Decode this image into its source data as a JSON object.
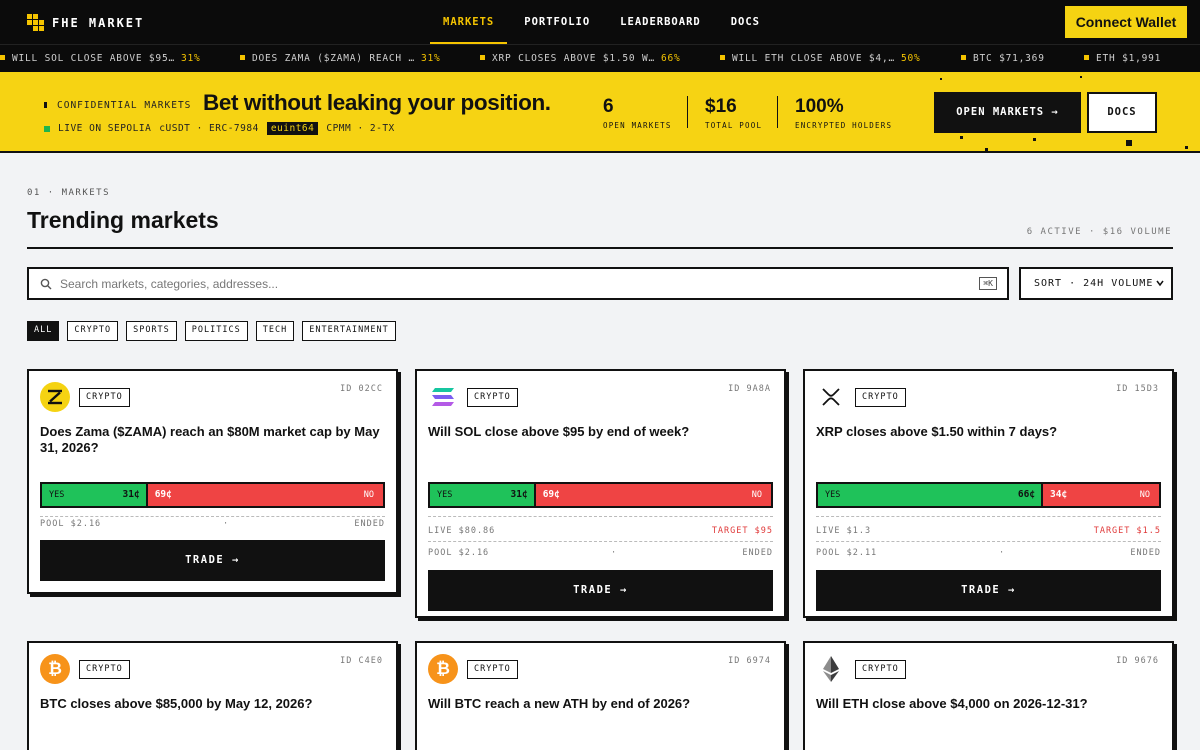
{
  "brand": {
    "name": "FHE MARKET"
  },
  "nav": {
    "items": [
      "MARKETS",
      "PORTFOLIO",
      "LEADERBOARD",
      "DOCS"
    ],
    "connect": "Connect Wallet"
  },
  "ticker": [
    {
      "text": "WILL SOL CLOSE ABOVE $95…",
      "pct": "31%"
    },
    {
      "text": "DOES ZAMA ($ZAMA) REACH …",
      "pct": "31%"
    },
    {
      "text": "XRP CLOSES ABOVE $1.50 W…",
      "pct": "66%"
    },
    {
      "text": "WILL ETH CLOSE ABOVE $4,…",
      "pct": "50%"
    },
    {
      "text": "BTC $71,369",
      "pct": ""
    },
    {
      "text": "ETH $1,991",
      "pct": ""
    }
  ],
  "hero": {
    "kicker": "CONFIDENTIAL MARKETS",
    "title": "Bet without leaking your position.",
    "live": "LIVE ON SEPOLIA",
    "token": "cUSDT · ERC-7984",
    "badge": "euint64",
    "amm": "CPMM · 2-TX",
    "stats": [
      {
        "value": "6",
        "label": "OPEN MARKETS"
      },
      {
        "value": "$16",
        "label": "TOTAL POOL"
      },
      {
        "value": "100%",
        "label": "ENCRYPTED HOLDERS"
      }
    ],
    "open_btn": "OPEN MARKETS →",
    "docs_btn": "DOCS"
  },
  "section": {
    "label": "01 · MARKETS",
    "title": "Trending markets",
    "meta": "6 ACTIVE · $16 VOLUME",
    "search_placeholder": "Search markets, categories, addresses...",
    "kbd": "⌘K",
    "sort": "SORT · 24H VOLUME"
  },
  "filters": [
    "ALL",
    "CRYPTO",
    "SPORTS",
    "POLITICS",
    "TECH",
    "ENTERTAINMENT"
  ],
  "cards": [
    {
      "tag": "CRYPTO",
      "id": "ID 02CC",
      "question": "Does Zama ($ZAMA) reach an $80M market cap by May 31, 2026?",
      "yes_label": "YES",
      "yes": "31¢",
      "yes_share": 0.31,
      "no": "69¢",
      "no_label": "NO",
      "live": "",
      "target": "",
      "pool": "POOL $2.16",
      "status": "ENDED",
      "trade": "TRADE →",
      "logo": "zama-logo"
    },
    {
      "tag": "CRYPTO",
      "id": "ID 9A8A",
      "question": "Will SOL close above $95 by end of week?",
      "yes_label": "YES",
      "yes": "31¢",
      "yes_share": 0.31,
      "no": "69¢",
      "no_label": "NO",
      "live": "LIVE $80.86",
      "target": "TARGET $95",
      "pool": "POOL $2.16",
      "status": "ENDED",
      "trade": "TRADE →",
      "logo": "solana-logo"
    },
    {
      "tag": "CRYPTO",
      "id": "ID 15D3",
      "question": "XRP closes above $1.50 within 7 days?",
      "yes_label": "YES",
      "yes": "66¢",
      "yes_share": 0.66,
      "no": "34¢",
      "no_label": "NO",
      "live": "LIVE $1.3",
      "target": "TARGET $1.5",
      "pool": "POOL $2.11",
      "status": "ENDED",
      "trade": "TRADE →",
      "logo": "xrp-logo"
    },
    {
      "tag": "CRYPTO",
      "id": "ID C4E0",
      "question": "BTC closes above $85,000 by May 12, 2026?",
      "logo": "bitcoin-logo"
    },
    {
      "tag": "CRYPTO",
      "id": "ID 6974",
      "question": "Will BTC reach a new ATH by end of 2026?",
      "logo": "bitcoin-logo"
    },
    {
      "tag": "CRYPTO",
      "id": "ID 9676",
      "question": "Will ETH close above $4,000 on 2026-12-31?",
      "logo": "ethereum-logo"
    }
  ],
  "colors": {
    "accent": "#f5d312",
    "yes": "#1fc25a",
    "no": "#ef4444",
    "ink": "#111111"
  }
}
